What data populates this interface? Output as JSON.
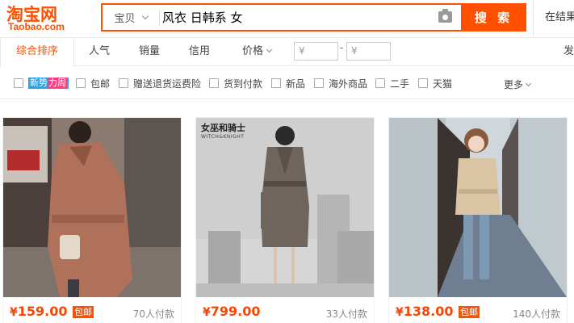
{
  "header": {
    "logo_cn": "淘宝网",
    "logo_en": "Taobao.com",
    "search_type": "宝贝",
    "search_query": "风衣 日韩系 女",
    "search_button": "搜 索",
    "right_text": "在结果"
  },
  "sortbar": {
    "items": [
      "综合排序",
      "人气",
      "销量",
      "信用",
      "价格"
    ],
    "price_from_placeholder": "¥",
    "price_to_placeholder": "¥",
    "price_dash": "-",
    "right_text": "发"
  },
  "filters": {
    "new_tag_left": "新势",
    "new_tag_right": "力周",
    "items": [
      "包邮",
      "赠送退货运费险",
      "货到付款",
      "新品",
      "海外商品",
      "二手",
      "天猫"
    ],
    "more": "更多"
  },
  "products": [
    {
      "price_symbol": "¥",
      "price": "159.00",
      "badge": "包邮",
      "sales": "70人付款"
    },
    {
      "price_symbol": "¥",
      "price": "799.00",
      "badge": "",
      "sales": "33人付款"
    },
    {
      "price_symbol": "¥",
      "price": "138.00",
      "badge": "包邮",
      "sales": "140人付款"
    }
  ],
  "product_brand_logo": "女巫和骑士",
  "product_brand_logo_en": "WITCH&KNIGHT",
  "colors": {
    "accent": "#ff5000",
    "price": "#ff4400"
  }
}
